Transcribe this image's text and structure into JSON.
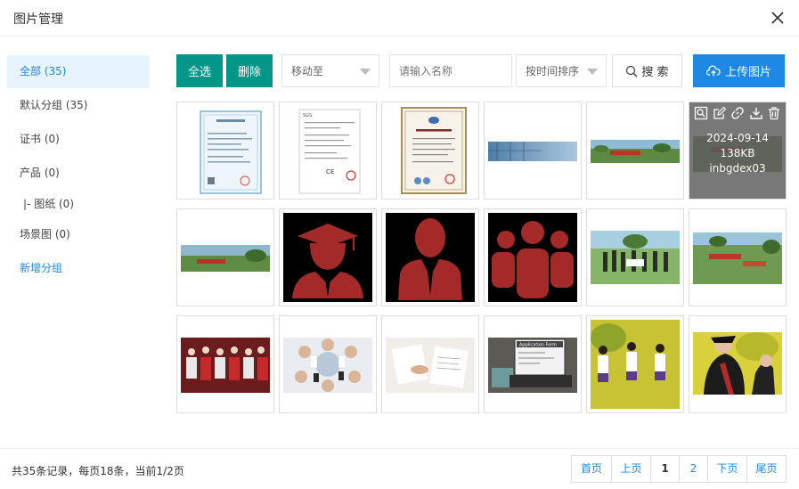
{
  "dialog": {
    "title": "图片管理"
  },
  "sidebar": {
    "items": [
      {
        "label": "全部 (35)"
      },
      {
        "label": "默认分组 (35)"
      },
      {
        "label": "证书 (0)"
      },
      {
        "label": "产品 (0)"
      },
      {
        "label": "|- 图纸 (0)"
      },
      {
        "label": "场景图 (0)"
      }
    ],
    "new_group": "新增分组"
  },
  "toolbar": {
    "select_all": "全选",
    "delete": "删除",
    "move_to": "移动至",
    "name_placeholder": "请输入名称",
    "sort": "按时间排序",
    "search": "搜 索",
    "upload": "上传图片"
  },
  "hover_card": {
    "date": "2024-09-14",
    "size": "138KB",
    "name": "inbgdex03"
  },
  "footer": {
    "summary": "共35条记录，每页18条，当前1/2页",
    "pager": [
      "首页",
      "上页",
      "1",
      "2",
      "下页",
      "尾页"
    ]
  },
  "colors": {
    "green": "#009688",
    "blue": "#1e88e5",
    "icon_red": "#a32a28"
  }
}
